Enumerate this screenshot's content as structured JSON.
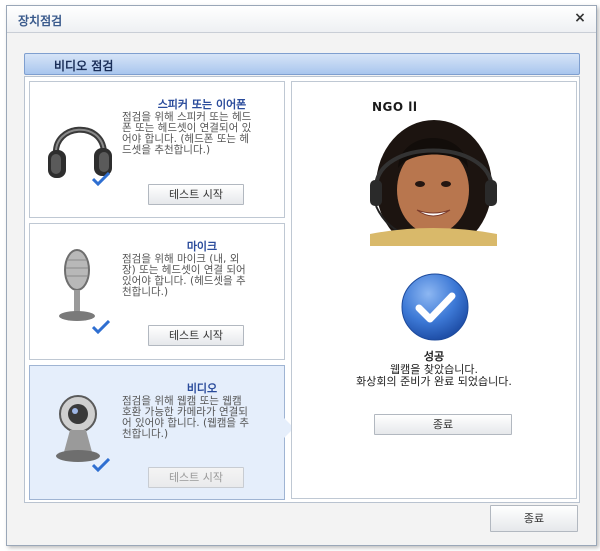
{
  "window": {
    "title": "장치점검",
    "close_label": "×"
  },
  "section": {
    "title": "비디오 점검"
  },
  "devices": [
    {
      "title": "스피커 또는 이어폰",
      "description": [
        "점검을 위해 스피커 또는 헤드",
        "폰 또는 헤드셋이 연결되어 있",
        "어야 합니다. (헤드폰 또는 헤",
        "드셋을 추천합니다.)"
      ],
      "button": "테스트 시작",
      "icon": "headphones-icon",
      "status": "checked"
    },
    {
      "title": "마이크",
      "description": [
        "점검을 위해 마이크 (내, 외",
        "장) 또는 헤드셋이 연결 되어",
        "있어야 합니다. (헤드셋을 추",
        "천합니다.)"
      ],
      "button": "테스트 시작",
      "icon": "microphone-icon",
      "status": "checked"
    },
    {
      "title": "비디오",
      "description": [
        "점검을 위해 웹캠 또는 웹캠",
        "호환 가능한 카메라가 연결되",
        "어 있어야 합니다. (웹캠을 추",
        "천합니다.)"
      ],
      "button": "테스트 시작",
      "icon": "webcam-icon",
      "status": "checked",
      "active": true
    }
  ],
  "preview": {
    "overlay_text": "NGO  ll"
  },
  "result": {
    "title": "성공",
    "message_line1": "웹캠을 찾았습니다.",
    "message_line2": "화상회의 준비가 완료 되었습니다.",
    "close_button": "종료"
  },
  "footer": {
    "close_button": "종료"
  },
  "colors": {
    "accent": "#2a4b9b",
    "success": "#3d79d6",
    "active_bg": "#e5eefb"
  }
}
